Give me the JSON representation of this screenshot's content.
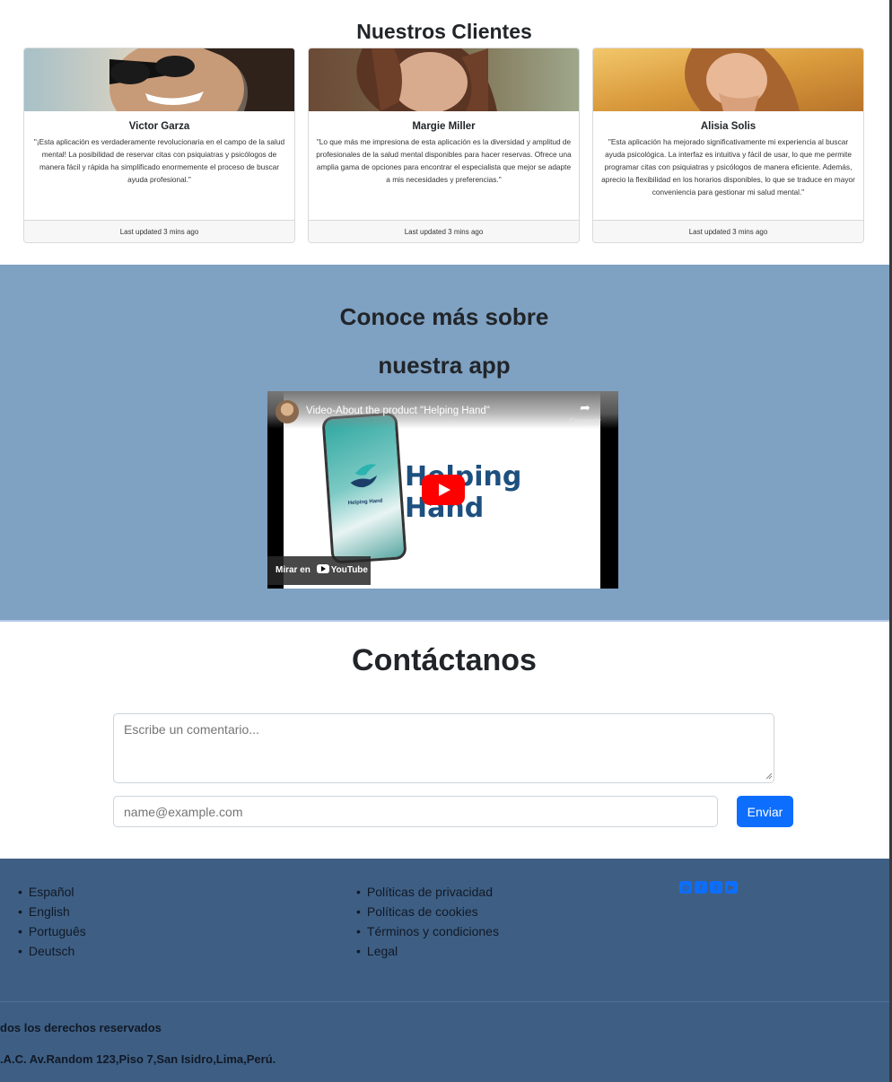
{
  "clients": {
    "title": "Nuestros Clientes",
    "cards": [
      {
        "name": "Victor Garza",
        "text": "\"¡Esta aplicación es verdaderamente revolucionaria en el campo de la salud mental! La posibilidad de reservar citas con psiquiatras y psicólogos de manera fácil y rápida ha simplificado enormemente el proceso de buscar ayuda profesional.\"",
        "footer": "Last updated 3 mins ago"
      },
      {
        "name": "Margie Miller",
        "text": "\"Lo que más me impresiona de esta aplicación es la diversidad y amplitud de profesionales de la salud mental disponibles para hacer reservas. Ofrece una amplia gama de opciones para encontrar el especialista que mejor se adapte a mis necesidades y preferencias.\"",
        "footer": "Last updated 3 mins ago"
      },
      {
        "name": "Alisia Solis",
        "text": "\"Esta aplicación ha mejorado significativamente mi experiencia al buscar ayuda psicológica. La interfaz es intuitiva y fácil de usar, lo que me permite programar citas con psiquiatras y psicólogos de manera eficiente. Además, aprecio la flexibilidad en los horarios disponibles, lo que se traduce en mayor conveniencia para gestionar mi salud mental.\"",
        "footer": "Last updated 3 mins ago"
      }
    ]
  },
  "app": {
    "title_line1": "Conoce más sobre",
    "title_line2": "nuestra app",
    "video": {
      "title": "Video-About the product \"Helping Hand\"",
      "share_label": "Compartir",
      "brand": "Helping Hand",
      "phone_label": "Helping Hand",
      "watch_on": "Mirar en",
      "youtube": "YouTube"
    }
  },
  "contact": {
    "title": "Contáctanos",
    "comment_placeholder": "Escribe un comentario...",
    "email_placeholder": "name@example.com",
    "send_label": "Enviar"
  },
  "footer": {
    "languages": [
      "Español",
      "English",
      "Português",
      "Deutsch"
    ],
    "policies": [
      "Políticas de privacidad",
      "Políticas de cookies",
      "Términos y condiciones",
      "Legal"
    ],
    "social": [
      "instagram-icon",
      "facebook-icon",
      "twitter-icon",
      "youtube-icon"
    ],
    "rights": "dos los derechos reservados",
    "address": ".A.C. Av.Random 123,Piso 7,San Isidro,Lima,Perú."
  },
  "colors": {
    "app_bg": "#7fa1c2",
    "footer_bg": "#3e5f83",
    "primary": "#0d6efd"
  }
}
